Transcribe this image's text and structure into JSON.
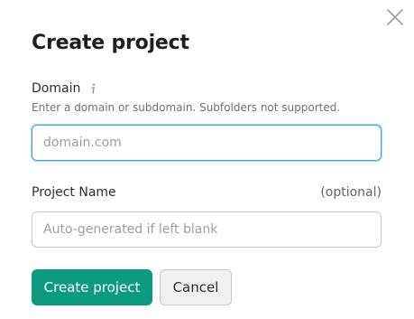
{
  "dialog": {
    "title": "Create project",
    "close_icon": "close-icon"
  },
  "domain": {
    "label": "Domain",
    "info_icon": "info-icon",
    "hint": "Enter a domain or subdomain. Subfolders not supported.",
    "placeholder": "domain.com",
    "value": ""
  },
  "project_name": {
    "label": "Project Name",
    "optional_label": "(optional)",
    "placeholder": "Auto-generated if left blank",
    "value": ""
  },
  "actions": {
    "create_label": "Create project",
    "cancel_label": "Cancel"
  },
  "colors": {
    "primary": "#0c9b7f",
    "focus_border": "#3fa9d6",
    "cancel_bg": "#eef0f2"
  }
}
